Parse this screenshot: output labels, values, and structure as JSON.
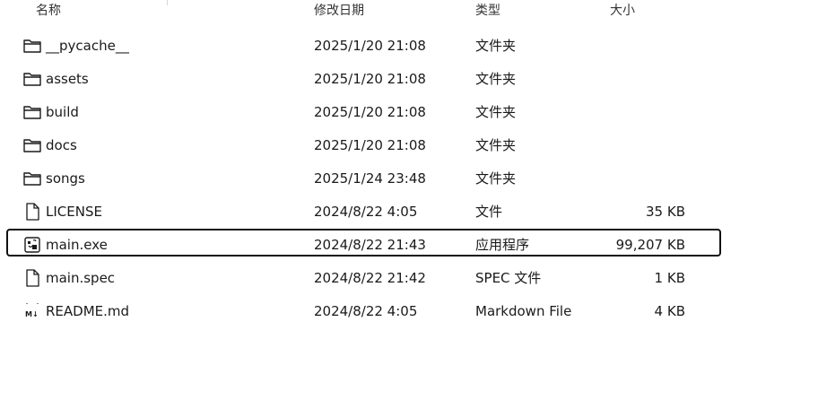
{
  "columns": {
    "name": "名称",
    "date_modified": "修改日期",
    "type": "类型",
    "size": "大小"
  },
  "files": [
    {
      "name": "__pycache__",
      "date": "2025/1/20 21:08",
      "type": "文件夹",
      "size": "",
      "icon": "folder-icon",
      "selected": false
    },
    {
      "name": "assets",
      "date": "2025/1/20 21:08",
      "type": "文件夹",
      "size": "",
      "icon": "folder-icon",
      "selected": false
    },
    {
      "name": "build",
      "date": "2025/1/20 21:08",
      "type": "文件夹",
      "size": "",
      "icon": "folder-icon",
      "selected": false
    },
    {
      "name": "docs",
      "date": "2025/1/20 21:08",
      "type": "文件夹",
      "size": "",
      "icon": "folder-icon",
      "selected": false
    },
    {
      "name": "songs",
      "date": "2025/1/24 23:48",
      "type": "文件夹",
      "size": "",
      "icon": "folder-icon",
      "selected": false
    },
    {
      "name": "LICENSE",
      "date": "2024/8/22 4:05",
      "type": "文件",
      "size": "35 KB",
      "icon": "document-icon",
      "selected": false
    },
    {
      "name": "main.exe",
      "date": "2024/8/22 21:43",
      "type": "应用程序",
      "size": "99,207 KB",
      "icon": "executable-icon",
      "selected": true
    },
    {
      "name": "main.spec",
      "date": "2024/8/22 21:42",
      "type": "SPEC 文件",
      "size": "1 KB",
      "icon": "document-icon",
      "selected": false
    },
    {
      "name": "README.md",
      "date": "2024/8/22 4:05",
      "type": "Markdown File",
      "size": "4 KB",
      "icon": "markdown-file-icon",
      "selected": false
    }
  ]
}
